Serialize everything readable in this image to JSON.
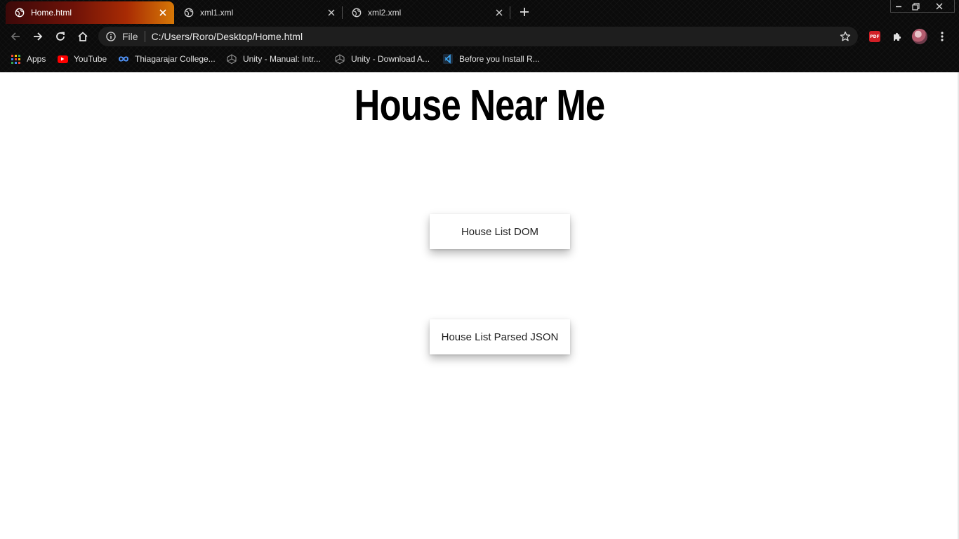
{
  "browser": {
    "tabs": [
      {
        "title": "Home.html",
        "active": true
      },
      {
        "title": "xml1.xml",
        "active": false
      },
      {
        "title": "xml2.xml",
        "active": false
      }
    ],
    "address": {
      "scheme_label": "File",
      "url": "C:/Users/Roro/Desktop/Home.html"
    },
    "bookmarks": [
      {
        "label": "Apps",
        "icon": "apps-grid-icon"
      },
      {
        "label": "YouTube",
        "icon": "youtube-icon"
      },
      {
        "label": "Thiagarajar College...",
        "icon": "infinity-icon"
      },
      {
        "label": "Unity - Manual: Intr...",
        "icon": "unity-icon"
      },
      {
        "label": "Unity - Download A...",
        "icon": "unity-icon"
      },
      {
        "label": "Before you Install R...",
        "icon": "vscode-icon"
      }
    ],
    "extensions": {
      "pdf_badge": "PDF"
    },
    "accent_colors": {
      "active_tab_gradient": [
        "#3d0909",
        "#6e1208",
        "#a82b04",
        "#d67806"
      ],
      "chrome_background": "#0b0b0b",
      "omnibox_background": "#1e1e1e"
    }
  },
  "page": {
    "title": "House Near Me",
    "buttons": [
      {
        "label": "House List DOM"
      },
      {
        "label": "House List Parsed JSON"
      }
    ]
  }
}
